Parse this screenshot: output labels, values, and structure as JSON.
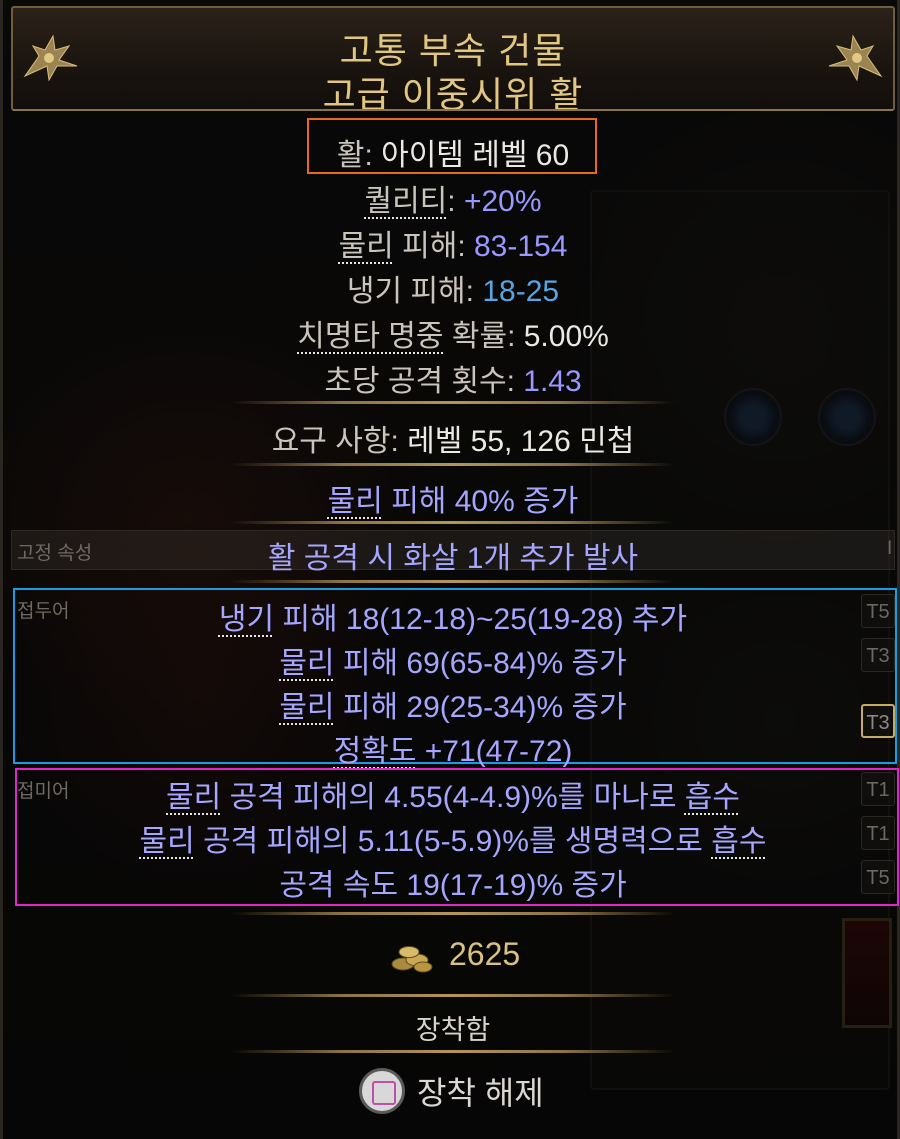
{
  "header": {
    "name": "고통 부속 건물",
    "base": "고급 이중시위 활"
  },
  "item_class": {
    "label": "활",
    "sep": ": ",
    "value": "아이템 레벨 60"
  },
  "stats": {
    "quality": {
      "label": "퀄리티",
      "sep": ": ",
      "value": "+20%"
    },
    "phys": {
      "label1": "물리",
      "label2": " 피해",
      "sep": ": ",
      "value": "83-154"
    },
    "cold": {
      "label": "냉기 피해",
      "sep": ": ",
      "value": "18-25"
    },
    "crit": {
      "label1": "치명타 명중",
      "label2": " 확률",
      "sep": ": ",
      "value": "5.00%"
    },
    "aps": {
      "label": "초당 공격 횟수",
      "sep": ": ",
      "value": "1.43"
    }
  },
  "requirements": {
    "label": "요구 사항",
    "sep": ": ",
    "value": "레벨 55, 126 민첩"
  },
  "implicit": {
    "kw": "물리",
    "rest": " 피해 40% 증가"
  },
  "fixed": {
    "tag": "고정 속성",
    "text": "활 공격 시 화살 1개 추가 발사",
    "marker": "I"
  },
  "prefix": {
    "tag": "접두어",
    "mods": [
      {
        "kw": "냉기",
        "rest": " 피해 18(12-18)~25(19-28) 추가",
        "tier": "T5"
      },
      {
        "kw": "물리",
        "rest": " 피해 69(65-84)% 증가",
        "tier": "T3"
      },
      {
        "kw": "물리",
        "rest": " 피해 29(25-34)% 증가",
        "tier": "T3"
      },
      {
        "kw": "정확도",
        "rest": " +71(47-72)"
      }
    ]
  },
  "suffix": {
    "tag": "접미어",
    "mods": [
      {
        "kw": "물리",
        "mid": " 공격 피해의 4.55(4-4.9)%를 마나로 ",
        "kw2": "흡수",
        "tier": "T1"
      },
      {
        "kw": "물리",
        "mid": " 공격 피해의 5.11(5-5.9)%를 생명력으로 ",
        "kw2": "흡수",
        "tier": "T1"
      },
      {
        "kw": "",
        "mid": "공격 속도 19(17-19)% 증가",
        "kw2": "",
        "tier": "T5"
      }
    ]
  },
  "price": {
    "value": "2625",
    "icon": "gold-coins-icon"
  },
  "equipped_label": "장착함",
  "unequip": {
    "label": "장착 해제",
    "icon": "square-button-icon"
  },
  "colors": {
    "item_name": "#e2c781",
    "magic_value": "#9a98ff",
    "cold_value": "#56a6e6",
    "item_class_box": "#e8691e",
    "prefix_box": "#1a9be6",
    "suffix_box": "#e026c8",
    "gold": "#d9c184"
  }
}
